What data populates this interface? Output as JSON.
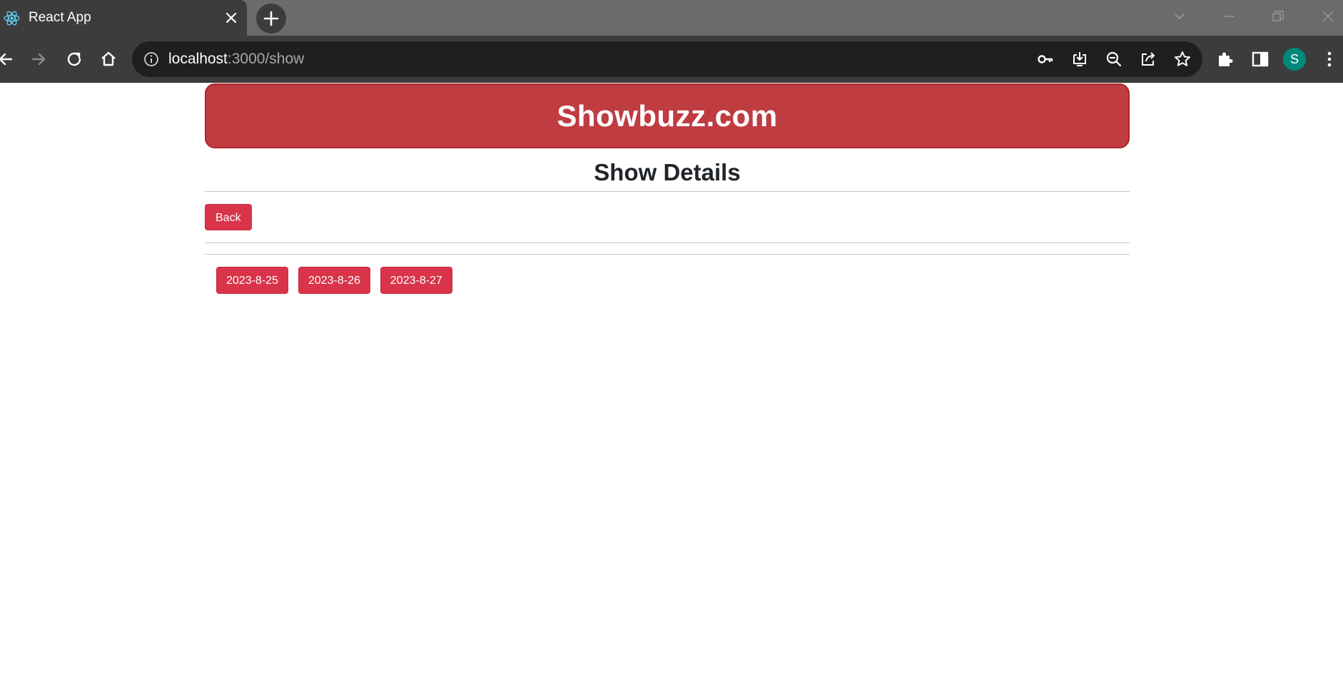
{
  "browser": {
    "tab": {
      "title": "React App",
      "favicon": "react-logo-icon"
    },
    "address_bar": {
      "host": "localhost",
      "path": ":3000/show"
    },
    "profile_initial": "S",
    "colors": {
      "tabstrip": "#6b6b6b",
      "toolbar": "#3c3c3c",
      "omnibox": "#1f1f1f",
      "avatar": "#00897b"
    }
  },
  "header": {
    "brand": "Showbuzz.com"
  },
  "main": {
    "title": "Show Details",
    "back_label": "Back",
    "dates": [
      {
        "label": "2023-8-25"
      },
      {
        "label": "2023-8-26"
      },
      {
        "label": "2023-8-27"
      }
    ]
  },
  "theme": {
    "banner": "#bf3c41",
    "button": "#d9344a",
    "text": "#212529"
  }
}
